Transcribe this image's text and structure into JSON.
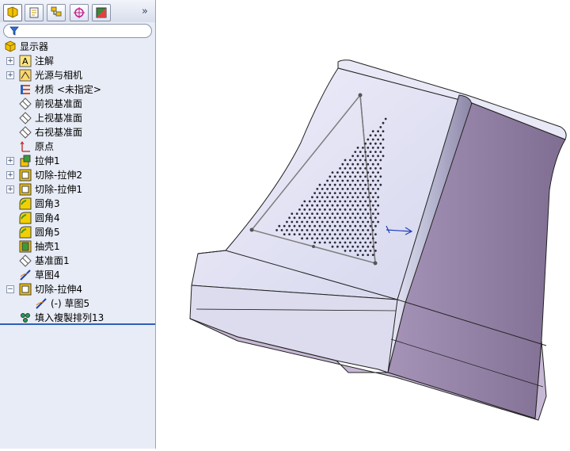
{
  "tabs": [
    {
      "name": "featuremanager"
    },
    {
      "name": "propertymanager"
    },
    {
      "name": "configurationmanager"
    },
    {
      "name": "dimxpertmanager"
    },
    {
      "name": "displaymanager"
    }
  ],
  "expand_glyph": "»",
  "tree": {
    "root": "显示器",
    "items": [
      {
        "label": "注解",
        "icon": "annotation-icon",
        "expandable": true
      },
      {
        "label": "光源与相机",
        "icon": "lights-cameras-icon",
        "expandable": true
      },
      {
        "label": "材质 <未指定>",
        "icon": "material-icon",
        "expandable": false
      },
      {
        "label": "前视基准面",
        "icon": "plane-icon",
        "expandable": false
      },
      {
        "label": "上视基准面",
        "icon": "plane-icon",
        "expandable": false
      },
      {
        "label": "右视基准面",
        "icon": "plane-icon",
        "expandable": false
      },
      {
        "label": "原点",
        "icon": "origin-icon",
        "expandable": false
      },
      {
        "label": "拉伸1",
        "icon": "extrude-icon",
        "expandable": true
      },
      {
        "label": "切除-拉伸2",
        "icon": "cut-extrude-icon",
        "expandable": true
      },
      {
        "label": "切除-拉伸1",
        "icon": "cut-extrude-icon",
        "expandable": true
      },
      {
        "label": "圆角3",
        "icon": "fillet-icon",
        "expandable": false
      },
      {
        "label": "圆角4",
        "icon": "fillet-icon",
        "expandable": false
      },
      {
        "label": "圆角5",
        "icon": "fillet-icon",
        "expandable": false
      },
      {
        "label": "抽壳1",
        "icon": "shell-icon",
        "expandable": false
      },
      {
        "label": "基准面1",
        "icon": "plane-icon",
        "expandable": false
      },
      {
        "label": "草图4",
        "icon": "sketch-icon",
        "expandable": false
      },
      {
        "label": "切除-拉伸4",
        "icon": "cut-extrude-icon",
        "expandable": true,
        "expanded": true
      },
      {
        "label": "(-) 草图5",
        "icon": "sketch-icon",
        "expandable": false,
        "child": true
      },
      {
        "label": "填入複製排列13",
        "icon": "fill-pattern-icon",
        "expandable": false
      }
    ]
  },
  "colors": {
    "panel_bg": "#e8ecf6",
    "body_light": "#e4e4f4",
    "body_shade": "#9c8caf",
    "accent_line": "#2e5fb8"
  }
}
